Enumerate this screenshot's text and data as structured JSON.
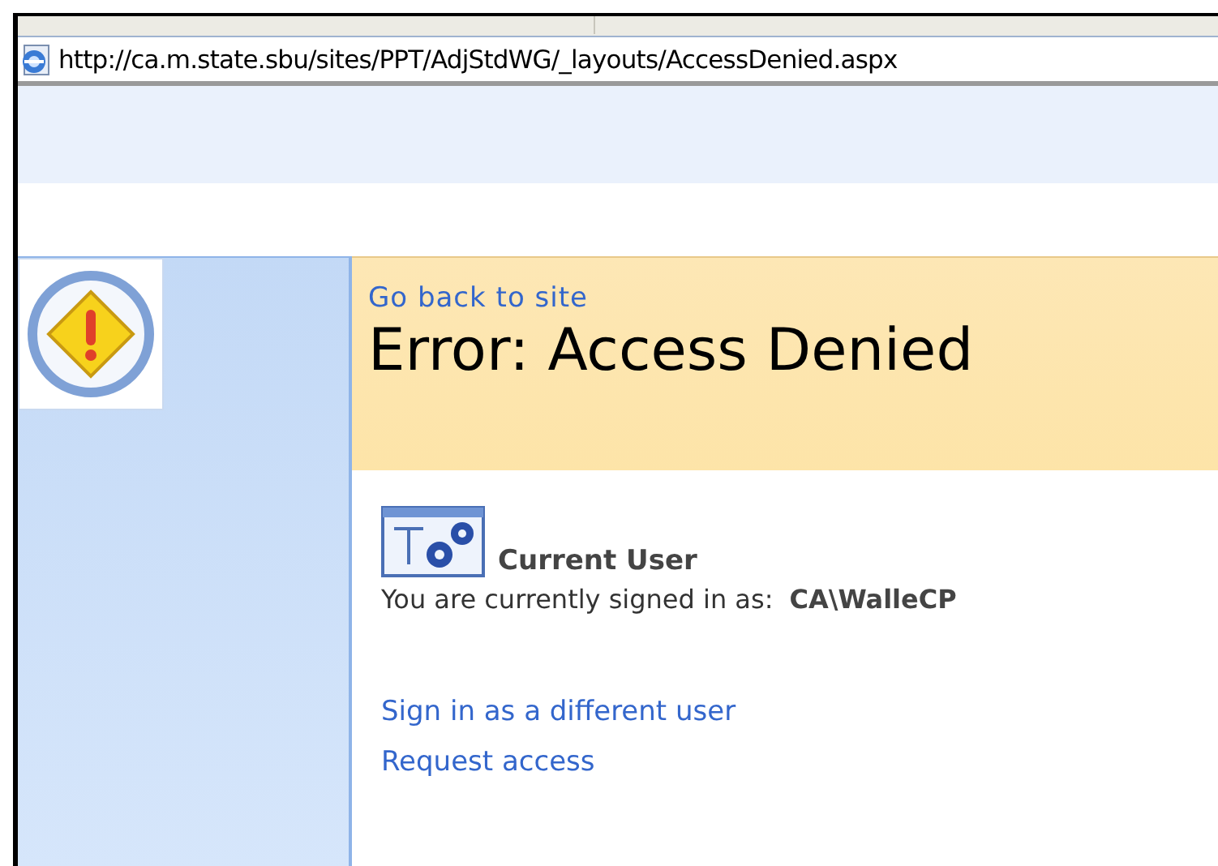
{
  "address_bar": {
    "url": "http://ca.m.state.sbu/sites/PPT/AdjStdWG/_layouts/AccessDenied.aspx"
  },
  "header": {
    "back_link": "Go back to site",
    "title": "Error: Access Denied"
  },
  "current_user": {
    "heading": "Current User",
    "signed_in_label": "You are currently signed in as:",
    "account": "CA\\WalleCP"
  },
  "links": [
    "Sign in as a different user",
    "Request access"
  ]
}
